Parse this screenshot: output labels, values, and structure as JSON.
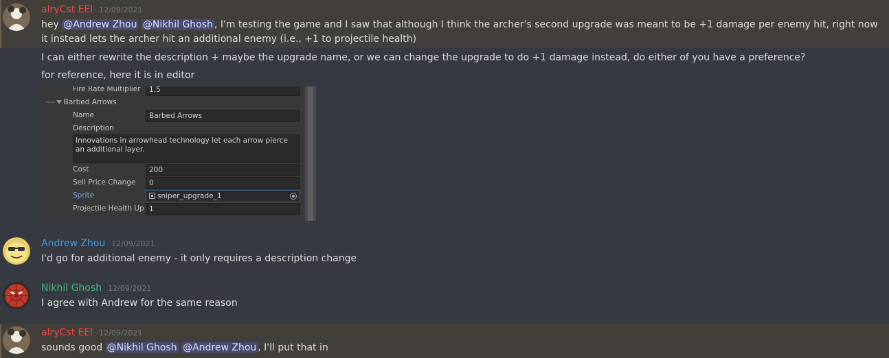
{
  "messages": [
    {
      "username": "alryCst EEl",
      "username_color": "#f04747",
      "timestamp": "12/09/2021",
      "avatar_icon": "user-avatar-icon",
      "line1_prefix": "hey",
      "line1_mention1": "@Andrew Zhou",
      "line1_mention2": "@Nikhil Ghosh",
      "line1_suffix": ", I'm testing the game and I saw that although I think the archer's second upgrade was meant to be +1 damage per enemy hit, right now it instead lets the archer hit an additional enemy (i.e., +1 to projectile health)",
      "line2": "I can either rewrite the description + maybe the upgrade name, or we can change the upgrade to do +1 damage instead, do either of you have a preference?",
      "line3": "for reference, here it is in editor"
    },
    {
      "username": "Andrew Zhou",
      "username_color": "#3b9ee8",
      "timestamp": "12/09/2021",
      "avatar_icon": "emoji-face-avatar-icon",
      "text": "I'd go for additional enemy - it only requires a description change"
    },
    {
      "username": "Nikhil Ghosh",
      "username_color": "#43b581",
      "timestamp": "12/09/2021",
      "avatar_icon": "spiderman-avatar-icon",
      "text": "I agree with Andrew for the same reason"
    },
    {
      "username": "alryCst EEl",
      "username_color": "#f04747",
      "timestamp": "12/09/2021",
      "avatar_icon": "user-avatar-icon",
      "prefix": "sounds good",
      "mention1": "@Nikhil Ghosh",
      "mention2": "@Andrew Zhou",
      "suffix": ", I'll put that in"
    }
  ],
  "editor": {
    "fire_rate_label": "Fire Rate Multiplier",
    "fire_rate_value": "1.5",
    "foldout_label": "Barbed Arrows",
    "name_label": "Name",
    "name_value": "Barbed Arrows",
    "description_label": "Description",
    "description_value": "Innovations in arrowhead technology let each arrow pierce an additional layer.",
    "cost_label": "Cost",
    "cost_value": "200",
    "sell_label": "Sell Price Change",
    "sell_value": "0",
    "sprite_label": "Sprite",
    "sprite_value": "sniper_upgrade_1",
    "projectile_label": "Projectile Health Up",
    "projectile_value": "1"
  }
}
